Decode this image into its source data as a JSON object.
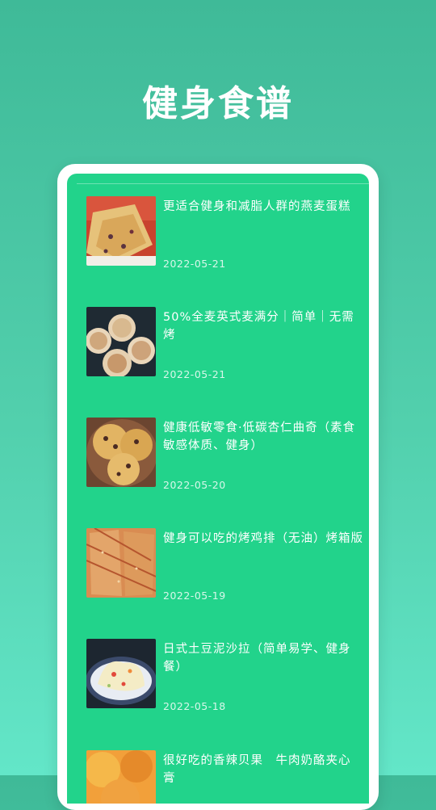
{
  "header": {
    "title": "健身食谱"
  },
  "recipes": [
    {
      "title": "更适合健身和减脂人群的燕麦蛋糕",
      "date": "2022-05-21",
      "image": "oat-cake"
    },
    {
      "title": "50%全麦英式麦满分｜简单｜无需烤",
      "date": "2022-05-21",
      "image": "english-muffins"
    },
    {
      "title": "健康低敏零食·低碳杏仁曲奇（素食敏感体质、健身）",
      "date": "2022-05-20",
      "image": "almond-cookies"
    },
    {
      "title": "健身可以吃的烤鸡排（无油）烤箱版",
      "date": "2022-05-19",
      "image": "baked-chicken"
    },
    {
      "title": "日式土豆泥沙拉（简单易学、健身餐）",
      "date": "2022-05-18",
      "image": "potato-salad"
    },
    {
      "title": "很好吃的香辣贝果　牛肉奶酪夹心　膏",
      "date": "",
      "image": "bagel"
    }
  ]
}
